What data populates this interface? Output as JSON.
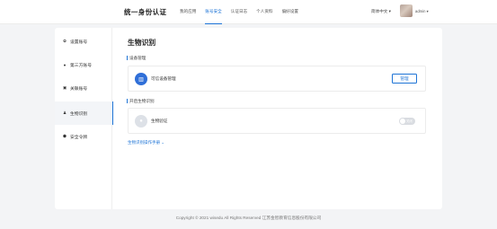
{
  "header": {
    "brand": "统一身份认证",
    "nav": [
      "我的应用",
      "账号安全",
      "认证日志",
      "个人资料",
      "偏好设置"
    ],
    "active_nav": "账号安全",
    "language": "简体中文",
    "language_caret": "▾",
    "username": "admin",
    "user_caret": "▾"
  },
  "sidebar": {
    "items": [
      {
        "label": "设置账号",
        "icon": "gear-icon",
        "glyph": "✿"
      },
      {
        "label": "第三方账号",
        "icon": "link-icon",
        "glyph": "●"
      },
      {
        "label": "关联账号",
        "icon": "account-card-icon",
        "glyph": "▣"
      },
      {
        "label": "生物识别",
        "icon": "biometric-icon",
        "glyph": "♟",
        "active": true
      },
      {
        "label": "安全令牌",
        "icon": "shield-icon",
        "glyph": "⬟"
      }
    ]
  },
  "main": {
    "title": "生物识别",
    "device_section": {
      "label": "设备管理",
      "row_icon": "device-list-icon",
      "row_glyph": "▥",
      "row_text": "可信设备管理",
      "button": "管理"
    },
    "bio_section": {
      "label": "开启生物识别",
      "row_icon": "user-face-icon",
      "row_glyph": "●",
      "row_text": "生物验证",
      "toggle_text": "关闭",
      "toggle_on": false
    },
    "manual_link": "生物识别操作手册",
    "manual_caret": "⌄"
  },
  "footer": {
    "copyright": "Copyright © 2021 wisedu All Rights Reserved 江苏金智教育信息股份有限公司"
  },
  "colors": {
    "accent": "#1e74d6",
    "background": "#f3f4f6",
    "card": "#ffffff"
  }
}
